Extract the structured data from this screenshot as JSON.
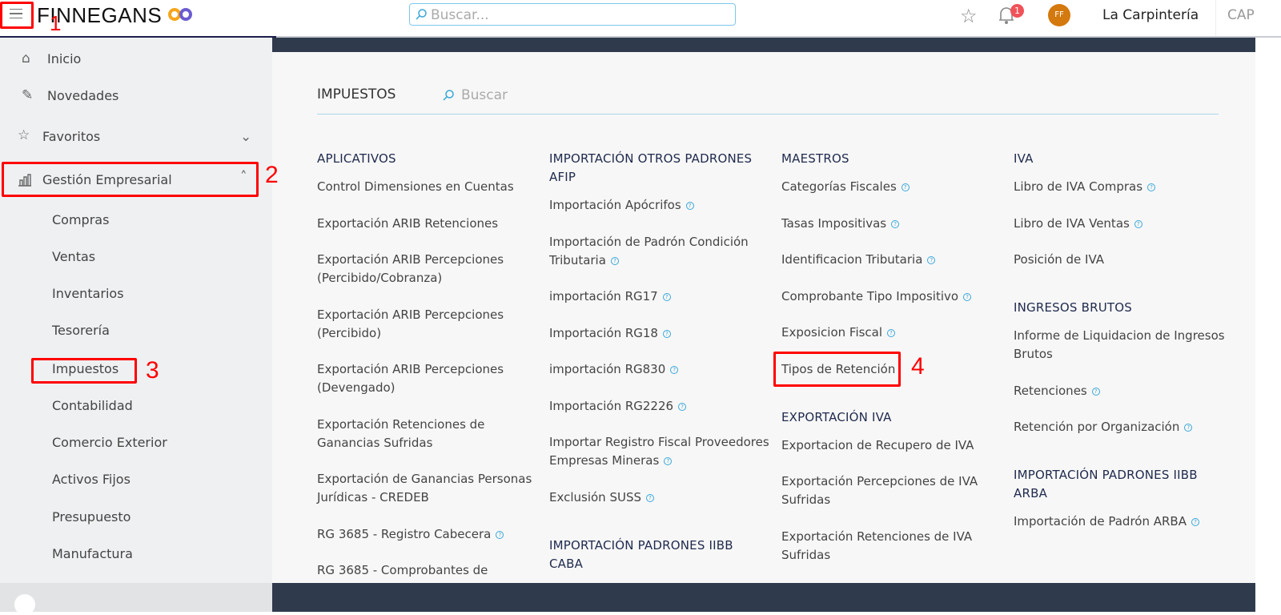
{
  "header": {
    "logo": "FINNEGANS",
    "search_placeholder": "Buscar...",
    "notification_count": "1",
    "avatar_initials": "FF",
    "company": "La Carpintería",
    "company_code": "CAP"
  },
  "sidebar": {
    "items": [
      {
        "label": "Inicio",
        "icon": "home-icon"
      },
      {
        "label": "Novedades",
        "icon": "pin-icon"
      },
      {
        "label": "Favoritos",
        "icon": "star-icon"
      },
      {
        "label": "Gestión Empresarial",
        "icon": "bar-chart-icon"
      }
    ],
    "subitems": [
      "Compras",
      "Ventas",
      "Inventarios",
      "Tesorería",
      "Impuestos",
      "Contabilidad",
      "Comercio Exterior",
      "Activos Fijos",
      "Presupuesto",
      "Manufactura"
    ]
  },
  "main": {
    "title": "IMPUESTOS",
    "search_placeholder": "Buscar",
    "columns": [
      [
        {
          "heading": "APLICATIVOS",
          "items": [
            {
              "label": "Control Dimensiones en Cuentas",
              "help": false
            },
            {
              "label": "Exportación ARIB Retenciones",
              "help": false
            },
            {
              "label": "Exportación ARIB Percepciones (Percibido/Cobranza)",
              "help": false
            },
            {
              "label": "Exportación ARIB Percepciones (Percibido)",
              "help": false
            },
            {
              "label": "Exportación ARIB Percepciones (Devengado)",
              "help": false
            },
            {
              "label": "Exportación Retenciones de Ganancias Sufridas",
              "help": false
            },
            {
              "label": "Exportación de Ganancias Personas Jurídicas - CREDEB",
              "help": false
            },
            {
              "label": "RG 3685 - Registro Cabecera",
              "help": true
            },
            {
              "label": "RG 3685 - Comprobantes de",
              "help": false
            }
          ]
        }
      ],
      [
        {
          "heading": "IMPORTACIÓN OTROS PADRONES AFIP",
          "items": [
            {
              "label": "Importación Apócrifos",
              "help": true
            },
            {
              "label": "Importación de Padrón Condición Tributaria",
              "help": true
            },
            {
              "label": "importación RG17",
              "help": true
            },
            {
              "label": "Importación RG18",
              "help": true
            },
            {
              "label": "importación RG830",
              "help": true
            },
            {
              "label": "Importación RG2226",
              "help": true
            },
            {
              "label": "Importar Registro Fiscal Proveedores Empresas Mineras",
              "help": true
            },
            {
              "label": "Exclusión SUSS",
              "help": true
            }
          ]
        },
        {
          "heading": "IMPORTACIÓN PADRONES IIBB CABA",
          "items": []
        }
      ],
      [
        {
          "heading": "MAESTROS",
          "items": [
            {
              "label": "Categorías Fiscales",
              "help": true
            },
            {
              "label": "Tasas Impositivas",
              "help": true
            },
            {
              "label": "Identificacion Tributaria",
              "help": true
            },
            {
              "label": "Comprobante Tipo Impositivo",
              "help": true
            },
            {
              "label": "Exposicion Fiscal",
              "help": true
            },
            {
              "label": "Tipos de Retención",
              "help": false
            }
          ]
        },
        {
          "heading": "EXPORTACIÓN IVA",
          "items": [
            {
              "label": "Exportacion de Recupero de IVA",
              "help": false
            },
            {
              "label": "Exportación Percepciones de IVA Sufridas",
              "help": false
            },
            {
              "label": "Exportación Retenciones de IVA Sufridas",
              "help": false
            }
          ]
        }
      ],
      [
        {
          "heading": "IVA",
          "items": [
            {
              "label": "Libro de IVA Compras",
              "help": true
            },
            {
              "label": "Libro de IVA Ventas",
              "help": true
            },
            {
              "label": "Posición de IVA",
              "help": false
            }
          ]
        },
        {
          "heading": "INGRESOS BRUTOS",
          "items": [
            {
              "label": "Informe de Liquidacion de Ingresos Brutos",
              "help": false
            },
            {
              "label": "Retenciones",
              "help": true
            },
            {
              "label": "Retención por Organización",
              "help": true
            }
          ]
        },
        {
          "heading": "IMPORTACIÓN PADRONES IIBB ARBA",
          "items": [
            {
              "label": "Importación de Padrón ARBA",
              "help": true
            }
          ]
        }
      ]
    ]
  },
  "annotations": [
    "1",
    "2",
    "3",
    "4"
  ],
  "colors": {
    "annotation": "#ff0000",
    "avatar": "#d4790d",
    "badge": "#f0525a",
    "dark_band": "#2f3a4d"
  }
}
